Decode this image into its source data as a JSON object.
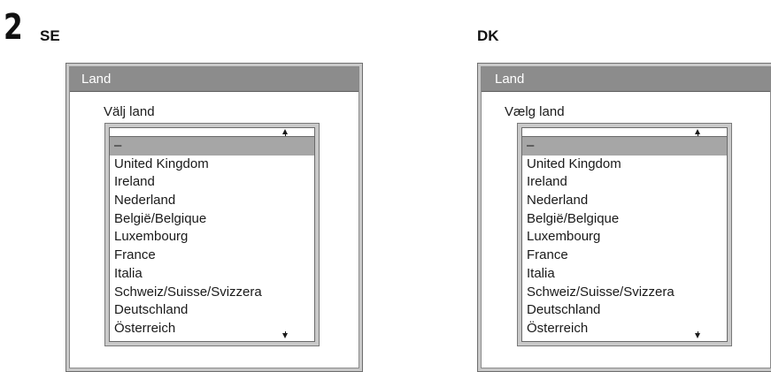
{
  "step_number": "2",
  "sections": [
    {
      "lang_code": "SE",
      "panel_title": "Land",
      "select_label": "Välj land",
      "selected_item": "–",
      "countries": [
        "United Kingdom",
        "Ireland",
        "Nederland",
        "België/Belgique",
        "Luxembourg",
        "France",
        "Italia",
        "Schweiz/Suisse/Svizzera",
        "Deutschland",
        "Österreich"
      ]
    },
    {
      "lang_code": "DK",
      "panel_title": "Land",
      "select_label": "Vælg land",
      "selected_item": "–",
      "countries": [
        "United Kingdom",
        "Ireland",
        "Nederland",
        "België/Belgique",
        "Luxembourg",
        "France",
        "Italia",
        "Schweiz/Suisse/Svizzera",
        "Deutschland",
        "Österreich"
      ]
    }
  ],
  "colors": {
    "header_bg": "#8c8c8c",
    "selected_row_bg": "#a6a6a6",
    "frame": "#c9c9c9"
  },
  "icons": {
    "scroll_up": "up-arrow-icon",
    "scroll_down": "down-arrow-icon"
  }
}
